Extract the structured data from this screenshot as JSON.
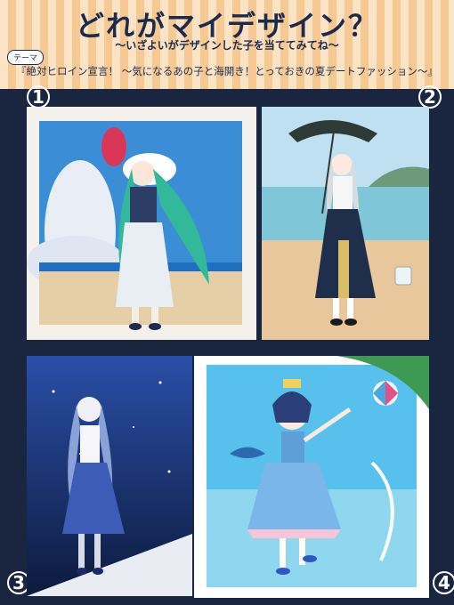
{
  "header": {
    "title": "どれがマイデザイン？",
    "subtitle": "〜いざよいがデザインした子を当ててみてね〜",
    "theme_tag": "テーマ",
    "theme_text": "『絶対ヒロイン宣言！ 〜気になるあの子と海開き！とっておきの夏デートファッション〜』"
  },
  "panels": [
    {
      "number": "1"
    },
    {
      "number": "2"
    },
    {
      "number": "3"
    },
    {
      "number": "4"
    }
  ]
}
